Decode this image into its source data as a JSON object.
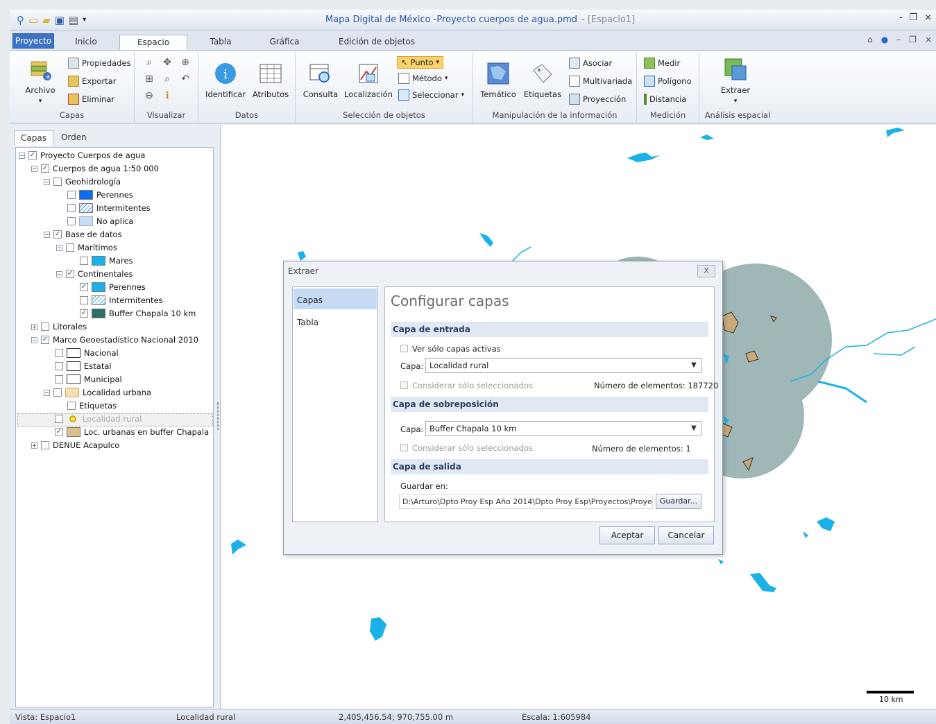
{
  "titlebar": {
    "title": "Mapa Digital de México -Proyecto cuerpos de agua.pmd",
    "subtitle": "- [Espacio1]",
    "controls": [
      "-",
      "❐",
      "×"
    ]
  },
  "tabs": {
    "proyecto": "Proyecto",
    "inicio": "Inicio",
    "espacio": "Espacio",
    "tabla": "Tabla",
    "grafica": "Gráfica",
    "edicion": "Edición de objetos"
  },
  "ribbon": {
    "capas": {
      "label": "Capas",
      "archivo": "Archivo",
      "propiedades": "Propiedades",
      "exportar": "Exportar",
      "eliminar": "Eliminar"
    },
    "visualizar": {
      "label": "Visualizar"
    },
    "datos": {
      "label": "Datos",
      "identificar": "Identificar",
      "atributos": "Atributos"
    },
    "seleccion": {
      "label": "Selección de objetos",
      "consulta": "Consulta",
      "localizacion": "Localización",
      "punto": "Punto",
      "metodo": "Método",
      "seleccionar": "Seleccionar"
    },
    "manipulacion": {
      "label": "Manipulación de la información",
      "tematico": "Temático",
      "etiquetas": "Etiquetas",
      "asociar": "Asociar",
      "multivariada": "Multivariada",
      "proyeccion": "Proyección"
    },
    "medicion": {
      "label": "Medición",
      "medir": "Medir",
      "poligono": "Polígono",
      "distancia": "Distancia"
    },
    "analisis": {
      "label": "Análisis espacial",
      "extraer": "Extraer"
    }
  },
  "panel": {
    "tab_capas": "Capas",
    "tab_orden": "Orden",
    "tree": {
      "proyecto": "Proyecto Cuerpos de agua",
      "cuerpos": "Cuerpos de agua 1:50 000",
      "geohidrologia": "Geohidrología",
      "perennes": "Perennes",
      "intermitentes": "Intermitentes",
      "no_aplica": "No aplica",
      "base_datos": "Base de datos",
      "maritimos": "Marítimos",
      "mares": "Mares",
      "continentales": "Continentales",
      "perennes2": "Perennes",
      "intermitentes2": "Intermitentes",
      "buffer": "Buffer Chapala 10 km",
      "litorales": "Litorales",
      "marco": "Marco Geoestadístico Nacional 2010",
      "nacional": "Nacional",
      "estatal": "Estatal",
      "municipal": "Municipal",
      "localidad_urbana": "Localidad urbana",
      "etiquetas": "Etiquetas",
      "localidad_rural": "Localidad rural",
      "loc_urbanas_buffer": "Loc. urbanas en buffer Chapala",
      "denue": "DENUE Acapulco"
    }
  },
  "dialog": {
    "title": "Extraer",
    "close": "X",
    "nav": {
      "capas": "Capas",
      "tabla": "Tabla"
    },
    "heading": "Configurar capas",
    "entrada": {
      "section": "Capa de entrada",
      "ver_activas": "Ver sólo capas activas",
      "capa_label": "Capa:",
      "capa_value": "Localidad rural",
      "considerar": "Considerar sólo seleccionados",
      "num_label": "Número de elementos:",
      "num_value": "187720"
    },
    "sobreposicion": {
      "section": "Capa de sobreposición",
      "capa_label": "Capa:",
      "capa_value": "Buffer Chapala 10 km",
      "considerar": "Considerar sólo seleccionados",
      "num_label": "Número de elementos:",
      "num_value": "1"
    },
    "salida": {
      "section": "Capa de salida",
      "guardar_label": "Guardar en:",
      "path": "D:\\Arturo\\Dpto Proy Esp Año 2014\\Dpto Proy Esp\\Proyectos\\Proye",
      "guardar_btn": "Guardar..."
    },
    "aceptar": "Aceptar",
    "cancelar": "Cancelar"
  },
  "map": {
    "scale_label": "10 km"
  },
  "statusbar": {
    "vista": "Vista: Espacio1",
    "capa": "Localidad rural",
    "coords": "2,405,456.54; 970,755.00 m",
    "escala": "Escala: 1:605984"
  },
  "colors": {
    "accent": "#3d72c4",
    "water": "#1ab1e8",
    "buffer": "#9fb7b7",
    "buffer_dark": "#2f6f6a",
    "urban": "#f5deb0"
  }
}
